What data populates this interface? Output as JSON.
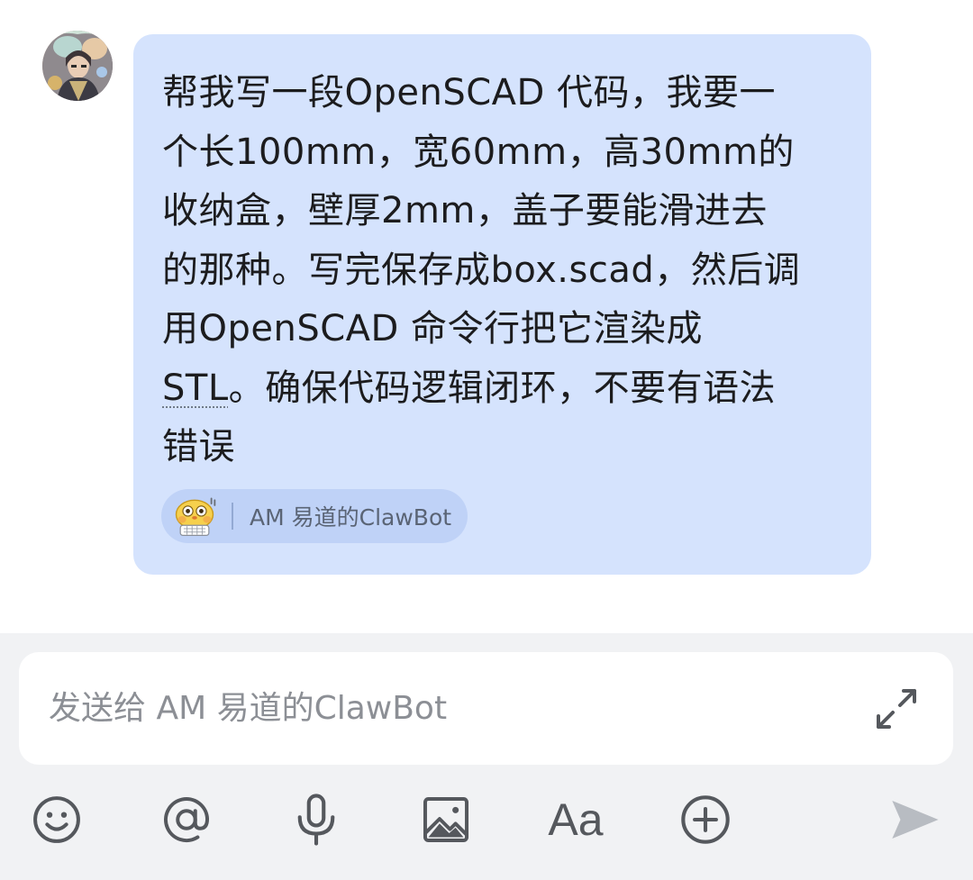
{
  "chat": {
    "message_lines": [
      "帮我写一段OpenSCAD 代码，我要一",
      "个长100mm，宽60mm，高30mm的",
      "收纳盒，壁厚2mm，盖子要能滑进去",
      "的那种。写完保存成box.scad，然后调",
      "用OpenSCAD 命令行把它渲染成"
    ],
    "message_line_6_underlined": "STL",
    "message_line_6_rest": "。确保代码逻辑闭环，不要有语法",
    "message_line_7": "错误",
    "bot_chip_label": "AM 易道的ClawBot",
    "bot_icon": "robot-face-icon"
  },
  "composer": {
    "placeholder": "发送给 AM 易道的ClawBot",
    "expand_icon": "expand-diagonal-icon"
  },
  "toolbar": {
    "icons": [
      "emoji-icon",
      "mention-icon",
      "microphone-icon",
      "image-icon",
      "font-format-icon",
      "add-circle-icon",
      "send-icon"
    ],
    "font_glyph": "Aa"
  },
  "colors": {
    "bubble": "#d5e3fd",
    "chip": "#bfd2f7",
    "composer_bg": "#f1f2f4",
    "icon": "#55585d",
    "send_icon": "#b8bcc2"
  }
}
